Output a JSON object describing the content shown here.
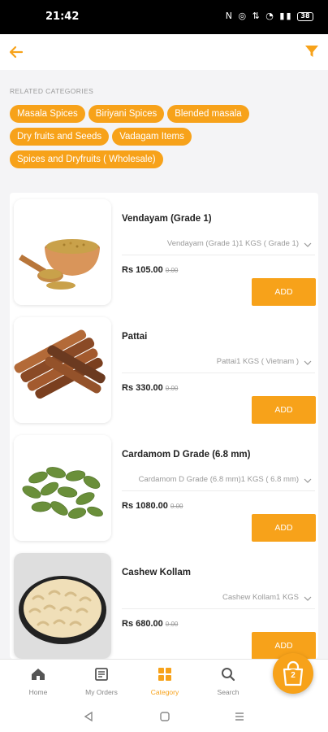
{
  "status_bar": {
    "time": "21:42",
    "icons_text": "N ◎ ⇅ ◔ ▮▮",
    "battery": "38"
  },
  "header": {
    "back_icon": "arrow-left-icon",
    "filter_icon": "funnel-icon"
  },
  "related_categories": {
    "title": "RELATED CATEGORIES",
    "items": [
      "Masala Spices",
      "Biriyani Spices",
      "Blended masala",
      "Dry fruits and Seeds",
      "Vadagam Items",
      "Spices and Dryfruits ( Wholesale)"
    ]
  },
  "products": [
    {
      "name": "Vendayam (Grade 1)",
      "variant": "Vendayam (Grade 1)1 KGS ( Grade 1)",
      "price": "Rs 105.00",
      "old_price": "0.00",
      "add_label": "ADD",
      "image": "fenugreek-seeds"
    },
    {
      "name": "Pattai",
      "variant": "Pattai1 KGS ( Vietnam )",
      "price": "Rs 330.00",
      "old_price": "0.00",
      "add_label": "ADD",
      "image": "cinnamon-sticks"
    },
    {
      "name": "Cardamom D Grade (6.8 mm)",
      "variant": "Cardamom D Grade (6.8 mm)1 KGS ( 6.8 mm)",
      "price": "Rs 1080.00",
      "old_price": "0.00",
      "add_label": "ADD",
      "image": "green-cardamom"
    },
    {
      "name": "Cashew Kollam",
      "variant": "Cashew Kollam1 KGS",
      "price": "Rs 680.00",
      "old_price": "0.00",
      "add_label": "ADD",
      "image": "cashew-nuts"
    }
  ],
  "bottom_nav": {
    "items": [
      {
        "label": "Home",
        "icon": "home-icon"
      },
      {
        "label": "My Orders",
        "icon": "orders-icon"
      },
      {
        "label": "Category",
        "icon": "category-icon",
        "active": true
      },
      {
        "label": "Search",
        "icon": "search-icon"
      }
    ]
  },
  "cart": {
    "count": "2",
    "icon": "shopping-bag-icon"
  },
  "colors": {
    "accent": "#f7a21a",
    "background": "#f4f4f6"
  }
}
